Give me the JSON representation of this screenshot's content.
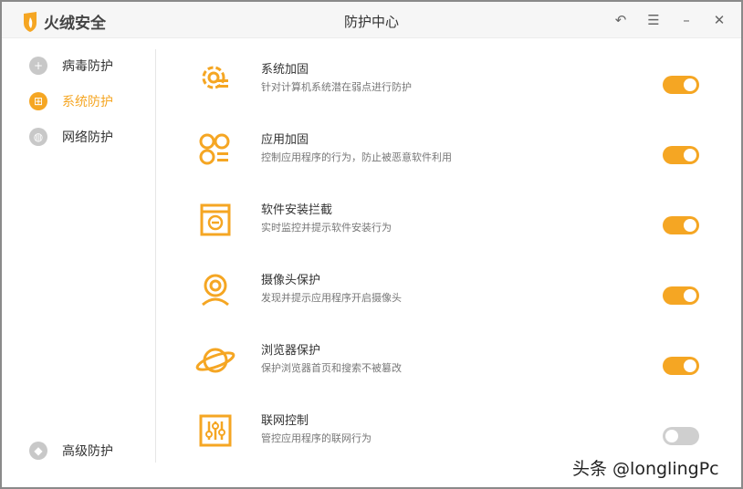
{
  "app": {
    "name": "火绒安全",
    "title": "防护中心"
  },
  "controls": {
    "back": "↶",
    "menu": "☰",
    "minimize": "–",
    "close": "✕"
  },
  "sidebar": {
    "items": [
      {
        "label": "病毒防护",
        "icon": "plus-shield-icon"
      },
      {
        "label": "系统防护",
        "icon": "windows-icon",
        "active": true
      },
      {
        "label": "网络防护",
        "icon": "globe-icon"
      }
    ],
    "bottom": {
      "label": "高级防护",
      "icon": "diamond-icon"
    }
  },
  "rows": [
    {
      "title": "系统加固",
      "desc": "针对计算机系统潜在弱点进行防护",
      "on": true,
      "icon": "gear-list-icon"
    },
    {
      "title": "应用加固",
      "desc": "控制应用程序的行为，防止被恶意软件利用",
      "on": true,
      "icon": "apps-icon"
    },
    {
      "title": "软件安装拦截",
      "desc": "实时监控并提示软件安装行为",
      "on": true,
      "icon": "install-block-icon"
    },
    {
      "title": "摄像头保护",
      "desc": "发现并提示应用程序开启摄像头",
      "on": true,
      "icon": "webcam-icon"
    },
    {
      "title": "浏览器保护",
      "desc": "保护浏览器首页和搜索不被篡改",
      "on": true,
      "icon": "planet-icon"
    },
    {
      "title": "联网控制",
      "desc": "管控应用程序的联网行为",
      "on": false,
      "icon": "sliders-icon"
    }
  ],
  "accent": "#f5a623",
  "watermark": "头条 @longlingPc"
}
